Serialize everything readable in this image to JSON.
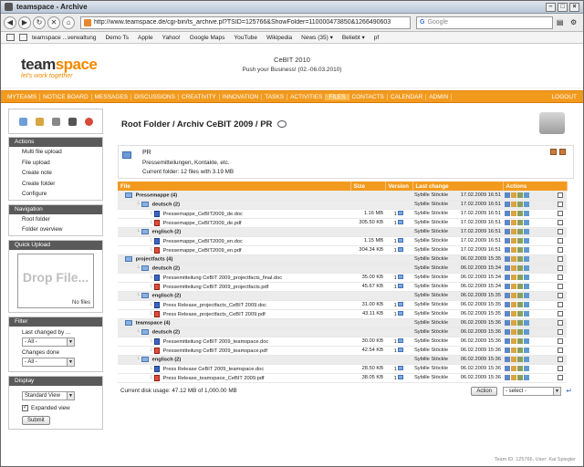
{
  "window": {
    "title": "teamspace - Archive"
  },
  "browser": {
    "url": "http://www.teamspace.de/cgi-bin/ts_archive.pl?TSID=125766&ShowFolder=110000473850&1266490603",
    "search_placeholder": "Google",
    "bookmarks": [
      "teamspace ...verwaltung",
      "Demo Ts",
      "Apple",
      "Yahoo!",
      "Google Maps",
      "YouTube",
      "Wikipedia",
      "News (35) ▾",
      "Beliebt ▾",
      "pf"
    ]
  },
  "header": {
    "logo_team": "team",
    "logo_space": "space",
    "logo_tagline": "let's work together",
    "event_title": "CeBIT 2010",
    "event_subtitle": "Push your Business! (02.-06.03.2010)"
  },
  "menu": [
    "MYTEAMS",
    "NOTICE BOARD",
    "MESSAGES",
    "DISCUSSIONS",
    "CREATIVITY",
    "INNOVATION",
    "TASKS",
    "ACTIVITIES",
    "FILES",
    "CONTACTS",
    "CALENDAR",
    "ADMIN"
  ],
  "menu_active": "FILES",
  "menu_logout": "LOGOUT",
  "sidebar": {
    "actions_title": "Actions",
    "actions": [
      "Multi file upload",
      "File upload",
      "Create note",
      "Create folder",
      "Configure"
    ],
    "navigation_title": "Navigation",
    "navigation": [
      "Root folder",
      "Folder overview"
    ],
    "quickupload_title": "Quick Upload",
    "drop_text": "Drop File...",
    "drop_files": "No files",
    "filter_title": "Filter",
    "filter_changed_by": "Last changed by ...",
    "filter_changed_by_value": "- All -",
    "filter_changes_done": "Changes done",
    "filter_changes_done_value": "- All -",
    "display_title": "Display",
    "display_view": "Standard View",
    "display_expanded": "Expanded view",
    "submit_label": "Submit"
  },
  "main": {
    "breadcrumb": "Root Folder / Archiv CeBIT 2009 / PR",
    "folder_name": "PR",
    "folder_desc": "Pressemitteilungen, Kontakte, etc.",
    "folder_stats": "Current folder: 12 files with 3.19 MB",
    "columns": [
      "File",
      "Size",
      "Version",
      "Last change",
      "Actions"
    ],
    "rows": [
      {
        "type": "folder",
        "indent": 1,
        "name": "Pressemappe (4)",
        "size": "",
        "version": "",
        "user": "Sybille Stöckle",
        "date": "17.02.2009 16:51"
      },
      {
        "type": "folder",
        "indent": 2,
        "name": "deutsch (2)",
        "size": "",
        "version": "",
        "user": "Sybille Stöckle",
        "date": "17.02.2009 16:51"
      },
      {
        "type": "doc",
        "indent": 3,
        "name": "Pressemappe_CeBIT2009_de.doc",
        "size": "1.16 MB",
        "version": "1",
        "user": "Sybille Stöckle",
        "date": "17.02.2009 16:51"
      },
      {
        "type": "pdf",
        "indent": 3,
        "name": "Pressemappe_CeBIT2009_de.pdf",
        "size": "305.50 KB",
        "version": "1",
        "user": "Sybille Stöckle",
        "date": "17.02.2009 16:51"
      },
      {
        "type": "folder",
        "indent": 2,
        "name": "englisch (2)",
        "size": "",
        "version": "",
        "user": "Sybille Stöckle",
        "date": "17.02.2009 16:51"
      },
      {
        "type": "doc",
        "indent": 3,
        "name": "Pressemappe_CeBIT2009_en.doc",
        "size": "1.15 MB",
        "version": "1",
        "user": "Sybille Stöckle",
        "date": "17.02.2009 16:51"
      },
      {
        "type": "pdf",
        "indent": 3,
        "name": "Pressemappe_CeBIT2009_en.pdf",
        "size": "304.34 KB",
        "version": "1",
        "user": "Sybille Stöckle",
        "date": "17.02.2009 16:51"
      },
      {
        "type": "folder",
        "indent": 1,
        "name": "projectfacts (4)",
        "size": "",
        "version": "",
        "user": "Sybille Stöckle",
        "date": "06.02.2009 15:35"
      },
      {
        "type": "folder",
        "indent": 2,
        "name": "deutsch (2)",
        "size": "",
        "version": "",
        "user": "Sybille Stöckle",
        "date": "06.02.2009 15:34"
      },
      {
        "type": "doc",
        "indent": 3,
        "name": "Pressemitteilung CeBIT 2009_projectfacts_final.doc",
        "size": "35.00 KB",
        "version": "1",
        "user": "Sybille Stöckle",
        "date": "06.02.2009 15:34"
      },
      {
        "type": "pdf",
        "indent": 3,
        "name": "Pressemitteilung CeBIT 2009_projectfacts.pdf",
        "size": "45.67 KB",
        "version": "1",
        "user": "Sybille Stöckle",
        "date": "06.02.2009 15:34"
      },
      {
        "type": "folder",
        "indent": 2,
        "name": "englisch (2)",
        "size": "",
        "version": "",
        "user": "Sybille Stöckle",
        "date": "06.02.2009 15:35"
      },
      {
        "type": "doc",
        "indent": 3,
        "name": "Press Release_projectfacts_CeBIT 2009.doc",
        "size": "31.00 KB",
        "version": "1",
        "user": "Sybille Stöckle",
        "date": "06.02.2009 15:35"
      },
      {
        "type": "pdf",
        "indent": 3,
        "name": "Press Release_projectfacts_CeBIT 2009.pdf",
        "size": "43.11 KB",
        "version": "1",
        "user": "Sybille Stöckle",
        "date": "06.02.2009 15:35"
      },
      {
        "type": "folder",
        "indent": 1,
        "name": "teamspace (4)",
        "size": "",
        "version": "",
        "user": "Sybille Stöckle",
        "date": "06.02.2009 15:36"
      },
      {
        "type": "folder",
        "indent": 2,
        "name": "deutsch (2)",
        "size": "",
        "version": "",
        "user": "Sybille Stöckle",
        "date": "06.02.2009 15:36"
      },
      {
        "type": "doc",
        "indent": 3,
        "name": "Pressemitteilung CeBIT 2009_teamspace.doc",
        "size": "30.00 KB",
        "version": "1",
        "user": "Sybille Stöckle",
        "date": "06.02.2009 15:36"
      },
      {
        "type": "pdf",
        "indent": 3,
        "name": "Pressemitteilung CeBIT 2009_teamspace.pdf",
        "size": "42.54 KB",
        "version": "1",
        "user": "Sybille Stöckle",
        "date": "06.02.2009 15:36"
      },
      {
        "type": "folder",
        "indent": 2,
        "name": "englisch (2)",
        "size": "",
        "version": "",
        "user": "Sybille Stöckle",
        "date": "06.02.2009 15:36"
      },
      {
        "type": "doc",
        "indent": 3,
        "name": "Press Release CeBIT 2009_teamspace.doc",
        "size": "28.50 KB",
        "version": "1",
        "user": "Sybille Stöckle",
        "date": "06.02.2009 15:36"
      },
      {
        "type": "pdf",
        "indent": 3,
        "name": "Press Release_teamspace_CeBIT 2009.pdf",
        "size": "38.05 KB",
        "version": "1",
        "user": "Sybille Stöckle",
        "date": "06.02.2009 15:36"
      }
    ],
    "disk_usage": "Current disk usage: 47.12 MB of 1,000.00 MB",
    "action_button": "Action",
    "action_select": "- select -",
    "team_footer": "Team ID: 125766, User: Kai Spiegler"
  },
  "colors": {
    "accent": "#f29a1e",
    "sidebar_header": "#5a5a5a"
  }
}
